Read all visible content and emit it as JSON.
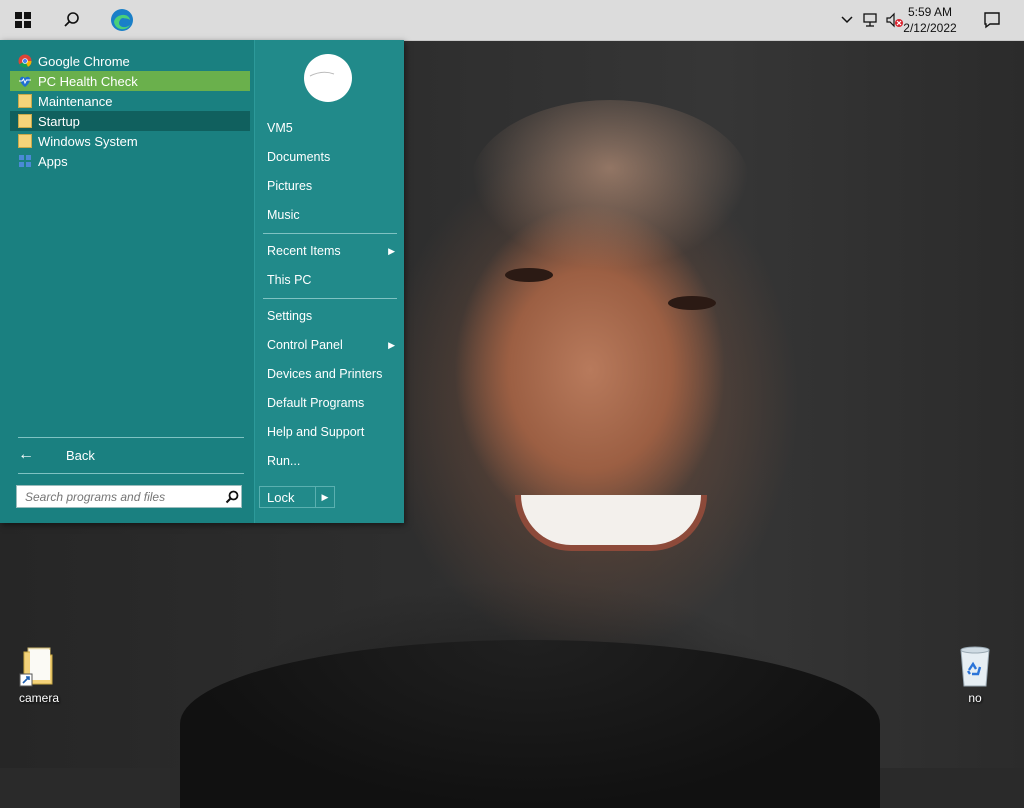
{
  "taskbar": {
    "clock_time": "5:59 AM",
    "clock_date": "2/12/2022"
  },
  "start_menu": {
    "programs": [
      {
        "label": "Google Chrome",
        "icon": "chrome-icon"
      },
      {
        "label": "PC Health Check",
        "icon": "pc-health-check-icon"
      },
      {
        "label": "Maintenance",
        "icon": "folder-icon"
      },
      {
        "label": "Startup",
        "icon": "folder-icon"
      },
      {
        "label": "Windows System",
        "icon": "folder-icon"
      },
      {
        "label": "Apps",
        "icon": "apps-icon"
      }
    ],
    "back_label": "Back",
    "search_placeholder": "Search programs and files",
    "right_items": [
      {
        "label": "VM5"
      },
      {
        "label": "Documents"
      },
      {
        "label": "Pictures"
      },
      {
        "label": "Music"
      },
      {
        "label": "Recent Items",
        "submenu": true
      },
      {
        "label": "This PC"
      },
      {
        "label": "Settings"
      },
      {
        "label": "Control Panel",
        "submenu": true
      },
      {
        "label": "Devices and Printers"
      },
      {
        "label": "Default Programs"
      },
      {
        "label": "Help and Support"
      },
      {
        "label": "Run..."
      }
    ],
    "lock_label": "Lock"
  },
  "desktop": {
    "icons": [
      {
        "label": "camera",
        "icon": "folder-shortcut-icon"
      },
      {
        "label": "no",
        "icon": "recycle-bin-icon"
      }
    ]
  },
  "colors": {
    "menu_bg": "#1e8585",
    "highlight_green": "#6ab04c",
    "highlight_dark": "#10605e",
    "taskbar": "#dcdcdc"
  }
}
